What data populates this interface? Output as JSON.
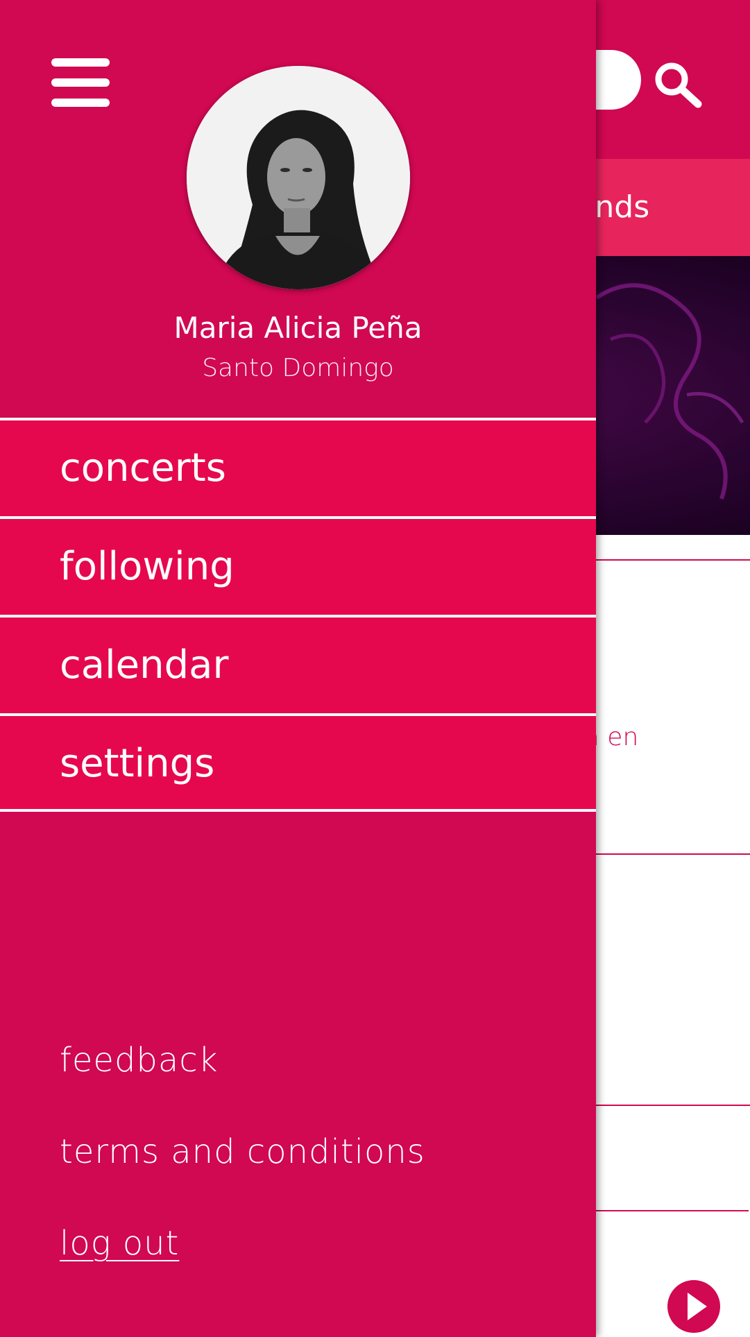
{
  "drawer": {
    "profile": {
      "name": "Maria Alicia Peña",
      "location": "Santo Domingo"
    },
    "menu": [
      {
        "label": "concerts"
      },
      {
        "label": "following"
      },
      {
        "label": "calendar"
      },
      {
        "label": "settings"
      }
    ],
    "footer_links": {
      "feedback": "feedback",
      "terms": "terms and conditions",
      "logout": "log out"
    }
  },
  "background": {
    "tab_partial_label": "riends",
    "description_partial": "ica en\ne."
  },
  "icons": {
    "menu": "hamburger-icon",
    "search": "search-icon",
    "play": "play-icon"
  },
  "colors": {
    "brand_primary": "#d10852",
    "menu_item_bg": "#e6084e",
    "tab_bar_bg": "#e8245c",
    "text_on_brand": "#ffffff"
  }
}
